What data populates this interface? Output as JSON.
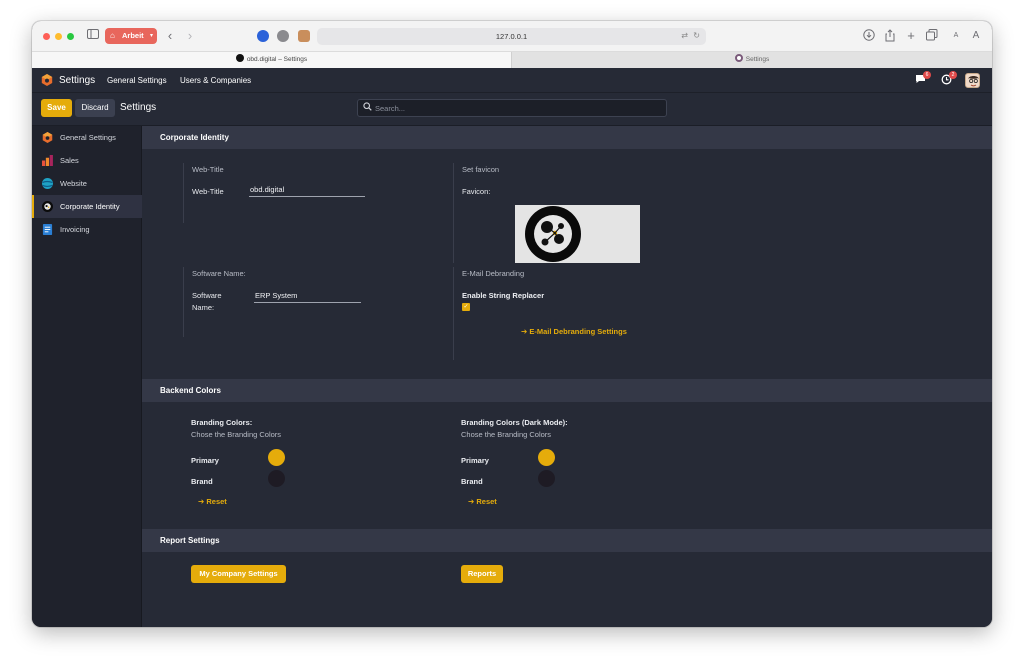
{
  "browser": {
    "profile_label": "Arbeit",
    "url": "127.0.0.1",
    "tabs": [
      {
        "label": "obd.digital – Settings",
        "active": true
      },
      {
        "label": "Settings",
        "active": false
      }
    ]
  },
  "navbar": {
    "app_name": "Settings",
    "menu": [
      "General Settings",
      "Users & Companies"
    ],
    "messages_count": "6",
    "activities_count": "2"
  },
  "control_panel": {
    "save_label": "Save",
    "discard_label": "Discard",
    "title": "Settings",
    "search_placeholder": "Search..."
  },
  "sidebar": {
    "items": [
      {
        "label": "General Settings",
        "icon": "odoo-settings-icon"
      },
      {
        "label": "Sales",
        "icon": "sales-icon"
      },
      {
        "label": "Website",
        "icon": "website-icon"
      },
      {
        "label": "Corporate Identity",
        "icon": "corporate-identity-icon",
        "active": true
      },
      {
        "label": "Invoicing",
        "icon": "invoicing-icon"
      }
    ]
  },
  "sections": {
    "corporate_identity": {
      "title": "Corporate Identity",
      "web_title_header": "Web-Title",
      "web_title_label": "Web-Title",
      "web_title_value": "obd.digital",
      "favicon_header": "Set favicon",
      "favicon_label": "Favicon:",
      "software_header": "Software Name:",
      "software_label_1": "Software",
      "software_label_2": "Name:",
      "software_value": "ERP System",
      "email_header": "E-Mail Debranding",
      "email_replacer_label": "Enable String Replacer",
      "email_replacer_checked": true,
      "email_link": "E-Mail Debranding Settings"
    },
    "backend_colors": {
      "title": "Backend Colors",
      "light": {
        "title": "Branding Colors:",
        "subtitle": "Chose the Branding Colors",
        "primary_label": "Primary",
        "brand_label": "Brand",
        "reset_label": "Reset"
      },
      "dark": {
        "title": "Branding Colors (Dark Mode):",
        "subtitle": "Chose the Branding Colors",
        "primary_label": "Primary",
        "brand_label": "Brand",
        "reset_label": "Reset"
      },
      "primary_color": "#e5ac0b",
      "brand_color": "#1e1b24"
    },
    "report_settings": {
      "title": "Report Settings",
      "company_button": "My Company Settings",
      "reports_button": "Reports"
    }
  },
  "colors": {
    "accent": "#e5ac0b",
    "background": "#262a36",
    "section_header": "#343847",
    "sidebar": "#1f222c"
  }
}
